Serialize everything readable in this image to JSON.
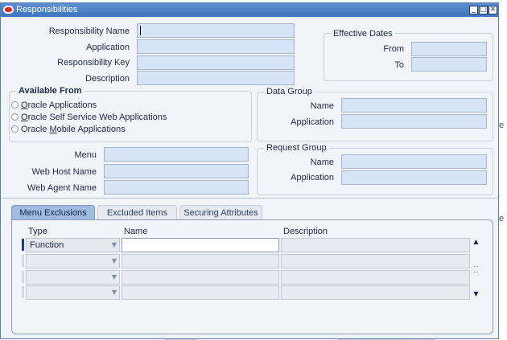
{
  "window": {
    "title": "Responsibilities"
  },
  "fields": {
    "responsibility_name_label": "Responsibility Name",
    "application_label": "Application",
    "responsibility_key_label": "Responsibility Key",
    "description_label": "Description"
  },
  "effective_dates": {
    "title": "Effective Dates",
    "from_label": "From",
    "to_label": "To"
  },
  "available_from": {
    "title": "Available From",
    "options": [
      {
        "underline": "O",
        "rest": "racle Applications"
      },
      {
        "underline": "O",
        "rest": "racle Self Service Web Applications"
      },
      {
        "pre": "Oracle ",
        "underline": "M",
        "rest": "obile Applications"
      }
    ]
  },
  "data_group": {
    "title": "Data Group",
    "name_label": "Name",
    "application_label": "Application"
  },
  "menu_section": {
    "menu_label": "Menu",
    "web_host_label": "Web Host Name",
    "web_agent_label": "Web Agent Name"
  },
  "request_group": {
    "title": "Request Group",
    "name_label": "Name",
    "application_label": "Application"
  },
  "tabs": [
    {
      "label": "Menu Exclusions",
      "active": true
    },
    {
      "label": "Excluded Items",
      "active": false
    },
    {
      "label": "Securing Attributes",
      "active": false
    }
  ],
  "grid": {
    "columns": [
      "Type",
      "Name",
      "Description"
    ],
    "rows": [
      {
        "type": "Function",
        "name": "",
        "description": ""
      },
      {
        "type": "",
        "name": "",
        "description": ""
      },
      {
        "type": "",
        "name": "",
        "description": ""
      },
      {
        "type": "",
        "name": "",
        "description": ""
      }
    ]
  },
  "background_fragments": {
    "letter_e_1": "e",
    "letter_e_2": "e"
  },
  "colors": {
    "titlebar": "#4a82c9",
    "field": "#d7e4f6",
    "active_tab": "#9fbbe0"
  }
}
